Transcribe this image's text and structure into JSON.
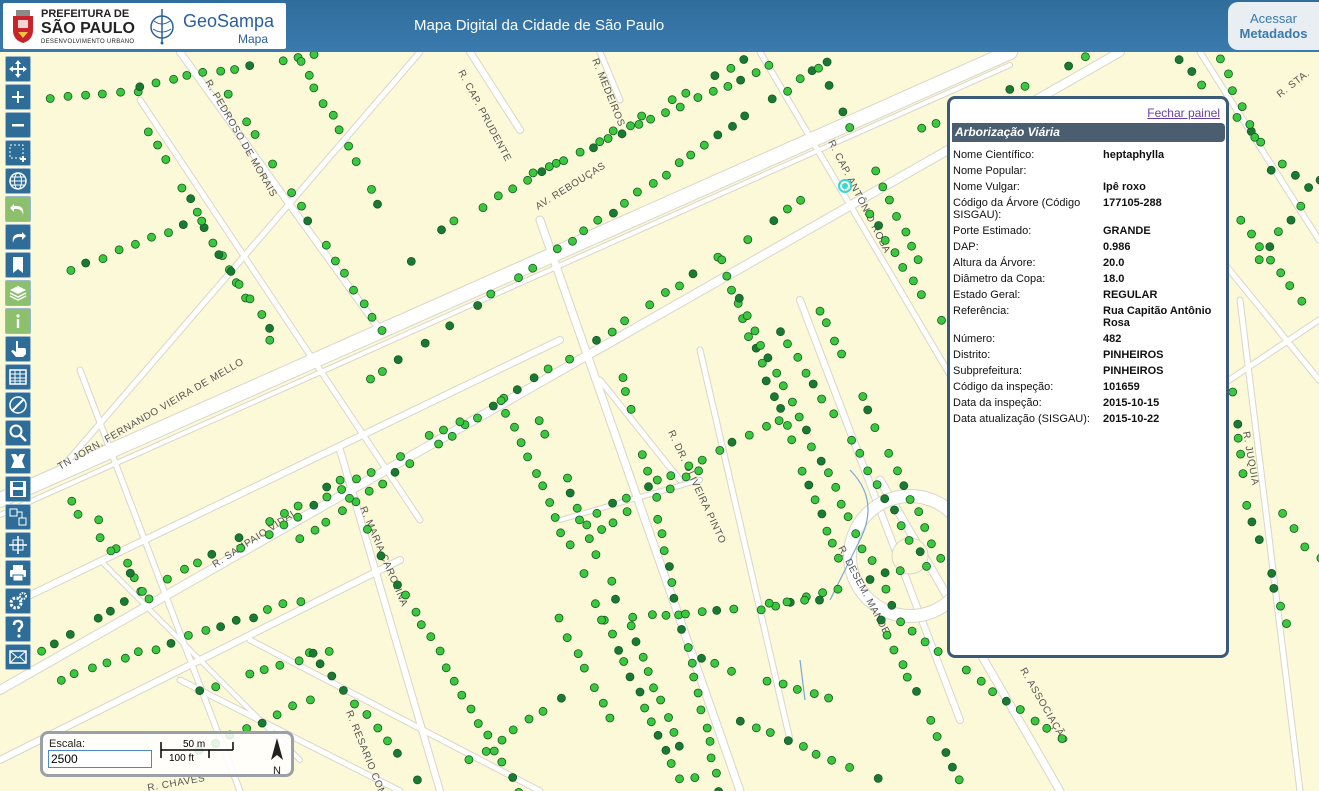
{
  "header": {
    "pref_line1": "PREFEITURA DE",
    "pref_line2": "SÃO PAULO",
    "pref_line3": "DESENVOLVIMENTO URBANO",
    "geosampa_name": "GeoSampa",
    "geosampa_sub": "Mapa",
    "title": "Mapa Digital da Cidade de São Paulo",
    "meta_line1": "Acessar",
    "meta_line2": "Metadados"
  },
  "toolbar": {
    "tools": [
      {
        "icon": "pan-icon",
        "active": false
      },
      {
        "icon": "zoom-in-icon",
        "active": false
      },
      {
        "icon": "zoom-out-icon",
        "active": false
      },
      {
        "icon": "zoom-box-icon",
        "active": false
      },
      {
        "icon": "globe-icon",
        "active": false
      },
      {
        "icon": "undo-icon",
        "active": true
      },
      {
        "icon": "redo-icon",
        "active": false
      },
      {
        "icon": "bookmark-icon",
        "active": false
      },
      {
        "icon": "layers-icon",
        "active": true
      },
      {
        "icon": "info-icon",
        "active": true
      },
      {
        "icon": "hand-pointer-icon",
        "active": false
      },
      {
        "icon": "table-icon",
        "active": false
      },
      {
        "icon": "measure-icon",
        "active": false
      },
      {
        "icon": "search-icon",
        "active": false
      },
      {
        "icon": "download-icon",
        "active": false
      },
      {
        "icon": "save-icon",
        "active": false
      },
      {
        "icon": "split-icon",
        "active": false
      },
      {
        "icon": "merge-icon",
        "active": false
      },
      {
        "icon": "print-icon",
        "active": false
      },
      {
        "icon": "settings-icon",
        "active": false
      },
      {
        "icon": "help-icon",
        "active": false
      },
      {
        "icon": "mail-icon",
        "active": false
      }
    ],
    "colors": {
      "default": "#2e6d98",
      "active": "#8cc06d"
    }
  },
  "street_labels": [
    "R. PEDROSO DE MORAIS",
    "R. CAP. PRUDENTE",
    "R. MEDEIROS",
    "AV. REBOUÇAS",
    "R. CAP. ANTÔNIO ROSA",
    "TN JORN. FERNANDO VIEIRA DE MELLO",
    "R. SAMPAIO VIDAL",
    "R. MARIA CAROLINA",
    "R. DR. OLIVEIRA PINTO",
    "R. DESEM. MANDE",
    "R. JUQUIA",
    "R. STA.",
    "R. RESARIO COMB",
    "R. CHAVES",
    "R. ASSOCIAÇÃO"
  ],
  "info_panel": {
    "close_label": "Fechar painel",
    "title": "Arborização Viária",
    "rows": [
      {
        "key": "Nome Científico:",
        "value": "heptaphylla"
      },
      {
        "key": "Nome Popular:",
        "value": ""
      },
      {
        "key": "Nome Vulgar:",
        "value": "Ipê roxo"
      },
      {
        "key": "Código da Árvore (Código SISGAU):",
        "value": "177105-288"
      },
      {
        "key": "Porte Estimado:",
        "value": "GRANDE"
      },
      {
        "key": "DAP:",
        "value": "0.986"
      },
      {
        "key": "Altura da Árvore:",
        "value": "20.0"
      },
      {
        "key": "Diâmetro da Copa:",
        "value": "18.0"
      },
      {
        "key": "Estado Geral:",
        "value": "REGULAR"
      },
      {
        "key": "Referência:",
        "value": "Rua Capitão Antônio Rosa"
      },
      {
        "key": "Número:",
        "value": "482"
      },
      {
        "key": "Distrito:",
        "value": "PINHEIROS"
      },
      {
        "key": "Subprefeitura:",
        "value": "PINHEIROS"
      },
      {
        "key": "Código da inspeção:",
        "value": "101659"
      },
      {
        "key": "Data da inspeção:",
        "value": "2015-10-15"
      },
      {
        "key": "Data atualização (SISGAU):",
        "value": "2015-10-22"
      }
    ]
  },
  "scale": {
    "label": "Escala:",
    "value": "2500",
    "bar_metric": "50 m",
    "bar_imperial": "100 ft",
    "north": "N"
  },
  "colors": {
    "map_bg": "#fbf9d8",
    "road": "#ffffff",
    "tree_light": "#3cc83c",
    "tree_dark": "#1a7a32",
    "header": "#3a7aad",
    "panel_border": "#3a5a79"
  }
}
